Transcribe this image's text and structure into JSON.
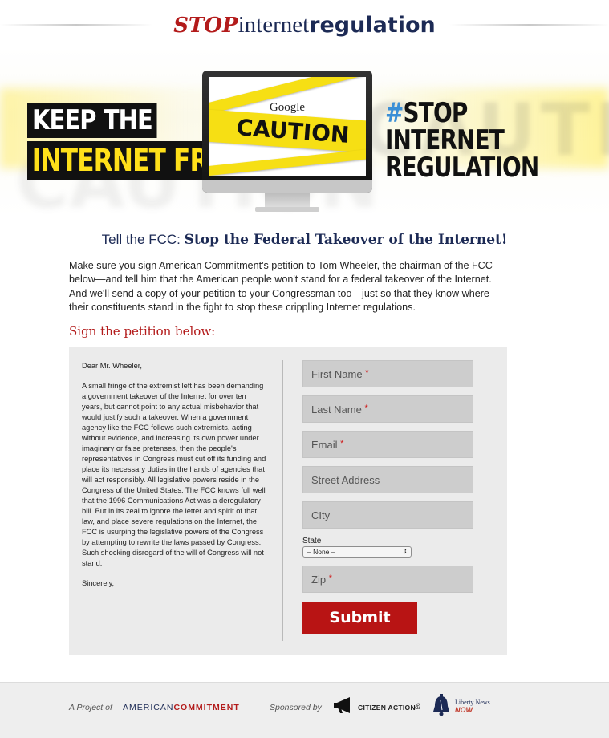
{
  "header": {
    "logo_stop": "STOP",
    "logo_internet": "internet",
    "logo_regulation": "regulation"
  },
  "hero": {
    "keep_line1": "KEEP THE",
    "keep_line2": "INTERNET FREE",
    "monitor_google": "Google",
    "monitor_caution": "CAUTION",
    "hashtag_symbol": "#",
    "hashtag_line1": "STOP",
    "hashtag_line2": "INTERNET",
    "hashtag_line3": "REGULATION",
    "background_text": "CAUTION"
  },
  "main": {
    "headline_prefix": "Tell the FCC: ",
    "headline_strong": "Stop the Federal Takeover of the Internet!",
    "intro": "Make sure you sign American Commitment's petition to Tom Wheeler, the chairman of the FCC below—and tell him that the American people won't stand for a federal takeover of the Internet. And we'll send a copy of your petition to your Congressman too—just so that they know where their constituents stand in the fight to stop these crippling Internet regulations.",
    "sign_label": "Sign the petition below:"
  },
  "letter": {
    "salutation": "Dear Mr. Wheeler,",
    "body": "A small fringe of the extremist left has been demanding a government takeover of the Internet for over ten years, but cannot point to any actual misbehavior that would justify such a takeover. When a government agency like the FCC follows such extremists, acting without evidence, and increasing its own power under imaginary or false pretenses, then the people's representatives in Congress must cut off its funding and place its necessary duties in the hands of agencies that will act responsibly. All legislative powers reside in the Congress of the United States. The FCC knows full well that the 1996 Communications Act was a deregulatory bill. But in its zeal to ignore the letter and spirit of that law, and place severe regulations on the Internet, the FCC is usurping the legislative powers of the Congress by attempting to rewrite the laws passed by Congress. Such shocking disregard of the will of Congress will not stand.",
    "closing": "Sincerely,"
  },
  "form": {
    "first_name": "First Name",
    "last_name": "Last Name",
    "email": "Email",
    "street": "Street Address",
    "city": "CIty",
    "state_label": "State",
    "state_value": "– None –",
    "zip": "Zip",
    "required_mark": "*",
    "submit_label": "Submit"
  },
  "footer": {
    "project_of": "A Project of",
    "american": "AMERICAN",
    "commitment": "COMMITMENT",
    "sponsored_by": "Sponsored by",
    "citizen_action": "CITIZEN ACTION",
    "amp": "&",
    "liberty_news": "Liberty News",
    "now": "NOW"
  },
  "colors": {
    "brand_red": "#b31b1b",
    "navy": "#1c2a55",
    "tape_yellow": "#f6df14",
    "submit_red": "#b81414"
  }
}
